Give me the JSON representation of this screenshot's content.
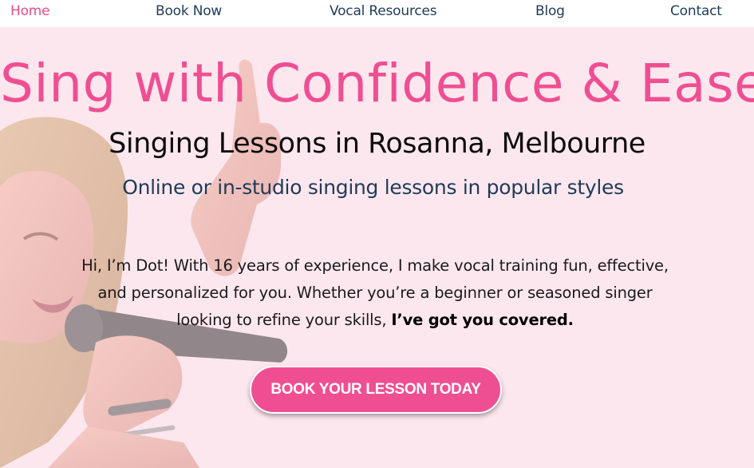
{
  "nav": {
    "items": [
      {
        "label": "Home",
        "active": true
      },
      {
        "label": "Book Now",
        "active": false
      },
      {
        "label": "Vocal Resources",
        "active": false
      },
      {
        "label": "Blog",
        "active": false
      },
      {
        "label": "Contact",
        "active": false
      }
    ]
  },
  "hero": {
    "title": "Sing with Confidence & Ease",
    "subtitle": "Singing Lessons in Rosanna, Melbourne",
    "tagline": "Online or in-studio singing lessons in popular styles",
    "body_text": "Hi, I’m Dot! With 16 years of experience, I make vocal training fun, effective, and personalized for you. Whether you’re a beginner or seasoned singer looking to refine your skills,",
    "body_emphasis": "I’ve got you covered.",
    "cta_label": "BOOK YOUR LESSON TODAY"
  },
  "colors": {
    "accent_pink": "#ef4f92",
    "nav_active": "#e94b8a",
    "nav_text": "#1f3b57",
    "hero_background": "#fde7ef"
  }
}
